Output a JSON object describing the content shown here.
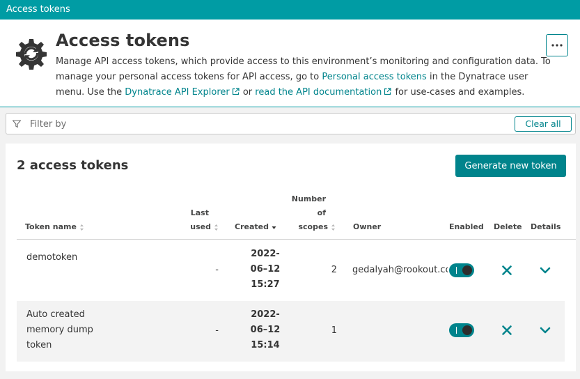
{
  "topbar": {
    "title": "Access tokens"
  },
  "header": {
    "title": "Access tokens",
    "desc_1": "Manage API access tokens, which provide access to this environment’s monitoring and configuration data. To manage your personal access tokens for API access, go to ",
    "personal_link": "Personal access tokens",
    "desc_2": " in the Dynatrace user menu. Use the ",
    "explorer_link": "Dynatrace API Explorer",
    "desc_3": " or ",
    "docs_link": "read the API documentation",
    "desc_4": " for use-cases and examples.",
    "more_icon": "more-horizontal-icon"
  },
  "filter": {
    "placeholder": "Filter by",
    "clear_label": "Clear all"
  },
  "panel": {
    "title": "2 access tokens",
    "generate_label": "Generate new token"
  },
  "table": {
    "columns": {
      "token_name": "Token name",
      "last_used_1": "Last",
      "last_used_2": "used",
      "created": "Created",
      "scopes_1": "Number",
      "scopes_2": "of",
      "scopes_3": "scopes",
      "owner": "Owner",
      "enabled": "Enabled",
      "delete": "Delete",
      "details": "Details"
    },
    "rows": [
      {
        "name_lines": [
          "demotoken"
        ],
        "last_used": "-",
        "created_lines": [
          "2022-",
          "06–12",
          "15:27"
        ],
        "scopes": "2",
        "owner": "gedalyah@rookout.com",
        "enabled": true
      },
      {
        "name_lines": [
          "Auto created",
          "memory dump",
          "token"
        ],
        "last_used": "-",
        "created_lines": [
          "2022-",
          "06–12",
          "15:14"
        ],
        "scopes": "1",
        "owner": "",
        "enabled": true
      }
    ]
  },
  "colors": {
    "accent": "#009ca4",
    "button": "#00848c",
    "text": "#353535"
  }
}
